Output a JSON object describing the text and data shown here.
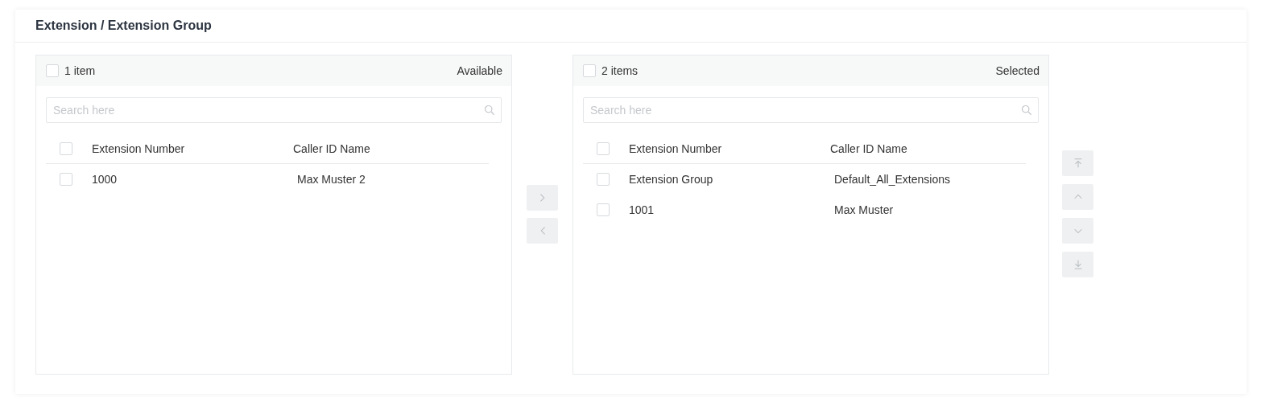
{
  "title": "Extension / Extension Group",
  "panels": [
    {
      "count": "1 item",
      "label": "Available",
      "checked": false,
      "search": {
        "placeholder": "Search here"
      },
      "columns": [
        "Extension Number",
        "Caller ID Name"
      ],
      "header_checked": false,
      "rows": [
        {
          "cells": [
            "1000",
            "Max Muster 2"
          ],
          "checked": false
        }
      ]
    },
    {
      "count": "2 items",
      "label": "Selected",
      "checked": false,
      "search": {
        "placeholder": "Search here"
      },
      "columns": [
        "Extension Number",
        "Caller ID Name"
      ],
      "header_checked": false,
      "rows": [
        {
          "cells": [
            "Extension Group",
            "Default_All_Extensions"
          ],
          "checked": false
        },
        {
          "cells": [
            "1001",
            "Max Muster"
          ],
          "checked": false
        }
      ]
    }
  ],
  "transfer_buttons": [
    {
      "kind": "right",
      "disabled": true
    },
    {
      "kind": "left",
      "disabled": true
    }
  ],
  "sort_buttons": [
    {
      "kind": "top",
      "disabled": true
    },
    {
      "kind": "up",
      "disabled": true
    },
    {
      "kind": "down",
      "disabled": true
    },
    {
      "kind": "bottom",
      "disabled": true
    }
  ]
}
